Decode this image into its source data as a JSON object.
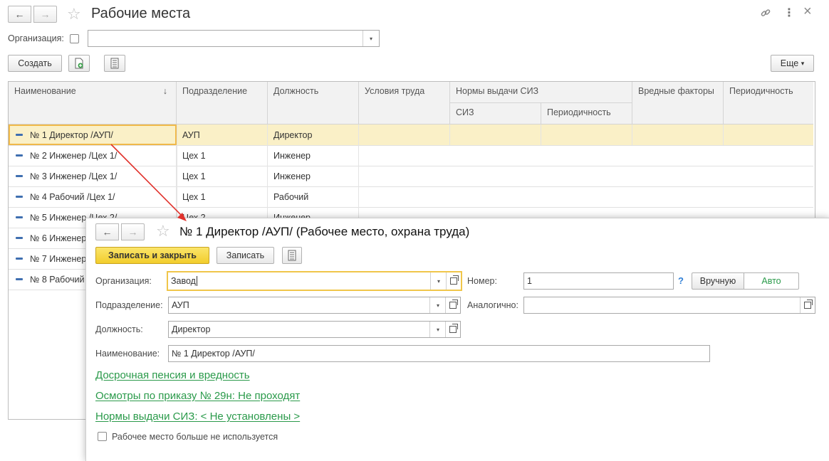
{
  "main": {
    "title": "Рабочие места",
    "org_label": "Организация:",
    "org_value": "",
    "create_label": "Создать",
    "more_label": "Еще",
    "more_arrow": "▾",
    "columns": {
      "name": "Наименование",
      "sort_indicator": "↓",
      "division": "Подразделение",
      "position": "Должность",
      "conditions": "Условия труда",
      "ppe_norms": "Нормы выдачи СИЗ",
      "ppe": "СИЗ",
      "ppe_periodicity": "Периодичность",
      "hazards": "Вредные факторы",
      "periodicity": "Периодичность"
    },
    "rows": [
      {
        "name": "№ 1 Директор /АУП/",
        "division": "АУП",
        "position": "Директор"
      },
      {
        "name": "№ 2 Инженер /Цех 1/",
        "division": "Цех 1",
        "position": "Инженер"
      },
      {
        "name": "№ 3 Инженер /Цех 1/",
        "division": "Цех 1",
        "position": "Инженер"
      },
      {
        "name": "№ 4 Рабочий /Цех 1/",
        "division": "Цех 1",
        "position": "Рабочий"
      },
      {
        "name": "№ 5 Инженер /Цех 2/",
        "division": "Цех 2",
        "position": "Инженер"
      },
      {
        "name": "№ 6 Инженер",
        "division": "",
        "position": ""
      },
      {
        "name": "№ 7 Инженер",
        "division": "",
        "position": ""
      },
      {
        "name": "№ 8 Рабочий",
        "division": "",
        "position": ""
      }
    ]
  },
  "dialog": {
    "title": "№ 1 Директор /АУП/ (Рабочее место, охрана труда)",
    "save_close_label": "Записать и закрыть",
    "save_label": "Записать",
    "org_label": "Организация:",
    "org_value": "Завод",
    "number_label": "Номер:",
    "number_value": "1",
    "help_mark": "?",
    "manual_label": "Вручную",
    "auto_label": "Авто",
    "division_label": "Подразделение:",
    "division_value": "АУП",
    "analog_label": "Аналогично:",
    "analog_value": "",
    "position_label": "Должность:",
    "position_value": "Директор",
    "name_label": "Наименование:",
    "name_value": "№ 1 Директор /АУП/",
    "link_pension": "Досрочная пенсия и вредность",
    "link_exams": "Осмотры по приказу № 29н: Не проходят",
    "link_ppe": "Нормы выдачи СИЗ: < Не установлены >",
    "unused_label": "Рабочее место больше не используется"
  },
  "colors": {
    "accent_yellow": "#f6d23a",
    "link_green": "#2a9a4a",
    "selection": "#faf0c7",
    "arrow_red": "#e0312b"
  },
  "icons": {
    "back": "←",
    "forward": "→",
    "star": "☆",
    "link": "🔗",
    "menu": "⋮",
    "close": "×",
    "dropdown": "▾"
  }
}
